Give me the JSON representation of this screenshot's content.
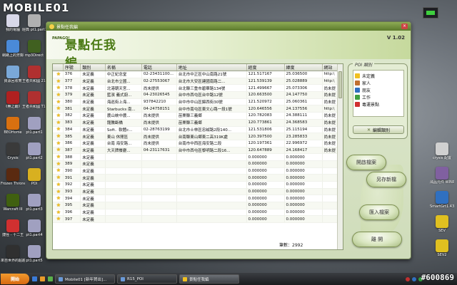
{
  "watermark": {
    "logo": "MOBILE01",
    "number": "#600869"
  },
  "desktop_icons": [
    {
      "label": "我的電腦",
      "color": "#d8d8e8"
    },
    {
      "label": "網路上的芳鄰",
      "color": "#4a8ad8"
    },
    {
      "label": "資源回收筒",
      "color": "#7aa8d8"
    },
    {
      "label": "《無之霸》",
      "color": "#b02020"
    },
    {
      "label": "BEOHome",
      "color": "#d87010"
    },
    {
      "label": "Crysis",
      "color": "#3a3a3a"
    },
    {
      "label": "Frozen Throne",
      "color": "#5a2a10"
    },
    {
      "label": "Warcraft III",
      "color": "#406010"
    },
    {
      "label": "捷徑 - 十二王",
      "color": "#d03030"
    },
    {
      "label": "來自世界的超越大戰",
      "color": "#303030"
    }
  ],
  "desktop_icons_col2": [
    {
      "label": "經典 pt1.part1",
      "color": "#b0b0b0"
    },
    {
      "label": "mp3Direct",
      "color": "#406020"
    },
    {
      "label": "王者共和國 2157",
      "color": "#b03030"
    },
    {
      "label": "王者共和國 T157",
      "color": "#b03030"
    },
    {
      "label": "pt1.part1",
      "color": "#a0a0c0"
    },
    {
      "label": "pt1.part2",
      "color": "#a0a0c0"
    },
    {
      "label": "POI",
      "color": "#d8b020"
    },
    {
      "label": "pt1.part3",
      "color": "#a0a0c0"
    },
    {
      "label": "pt1.part4",
      "color": "#a0a0c0"
    },
    {
      "label": "pt1.part5",
      "color": "#a0a0c0"
    }
  ],
  "desktop_icons_right": [
    {
      "label": "crysis 配置",
      "color": "#d0d0d0"
    },
    {
      "label": "飛品元件 WINRAR",
      "color": "#8060a0"
    },
    {
      "label": "SmartGrt1.43",
      "color": "#3070c0"
    },
    {
      "label": "SEV",
      "color": "#e0c020"
    },
    {
      "label": "SEV2",
      "color": "#e0c020"
    }
  ],
  "app": {
    "title": "景點任我編",
    "close": "×",
    "brand_small": "PAPAGO!",
    "brand_main": "景點任我編",
    "version": "V 1.02",
    "columns": [
      "",
      "序號",
      "類別",
      "名稱",
      "電話",
      "地址",
      "經度",
      "緯度",
      "網站"
    ],
    "rows": [
      [
        "376",
        "未定義",
        "中正紀念堂",
        "02-23431100...",
        "台北市中正區中山南路21號",
        "121.517167",
        "25.036500",
        "http:\\"
      ],
      [
        "377",
        "未定義",
        "台北市立國...",
        "02-27553067",
        "台北市大安區建國南路二...",
        "121.539139",
        "25.028889",
        "http:\\"
      ],
      [
        "378",
        "未定義",
        "北港朝天宮...",
        "尚未提供",
        "台北縣三重市碧華路134號",
        "121.499667",
        "25.073306",
        "尚未提"
      ],
      [
        "379",
        "未定義",
        "藍濱 義式廚...",
        "04-23026545",
        "台中市西屯區台中路12號",
        "120.663500",
        "24.147750",
        "尚未提"
      ],
      [
        "380",
        "未定義",
        "海巡街上海...",
        "937842210",
        "台中市中山區錦西街30號",
        "121.520972",
        "25.060361",
        "尚未提"
      ],
      [
        "381",
        "未定義",
        "Starbucks 南...",
        "04-24758151",
        "台中市南屯區東文心路一段1號",
        "120.646556",
        "24.137556",
        "http:\\"
      ],
      [
        "382",
        "未定義",
        "農山峽中農...",
        "尚未提供",
        "苗栗縣三義鄉",
        "120.782083",
        "24.388111",
        "尚未提"
      ],
      [
        "383",
        "未定義",
        "龍騰斷橋",
        "尚未提供",
        "苗栗縣三義鄉",
        "120.773861",
        "24.368583",
        "尚未提"
      ],
      [
        "384",
        "未定義",
        "Soft．軟體c...",
        "02-28763199",
        "台北市士林區忠誠路2段140...",
        "121.531806",
        "25.115194",
        "尚未提"
      ],
      [
        "385",
        "未定義",
        "東山 休閒區",
        "尚未提供",
        "台南縣東山鄉東二高319K處",
        "120.397500",
        "23.285833",
        "尚未提"
      ],
      [
        "386",
        "未定義",
        "台南 海安路...",
        "尚未提供",
        "台南市中西區海安路二段",
        "120.197361",
        "22.996972",
        "尚未提"
      ],
      [
        "387",
        "未定義",
        "大天牌餐廳...",
        "04-23117631",
        "台中市西屯區黎明路二段16...",
        "120.647889",
        "24.168417",
        "尚未提"
      ],
      [
        "388",
        "未定義",
        "",
        "",
        "",
        "0.000000",
        "0.000000",
        ""
      ],
      [
        "389",
        "未定義",
        "",
        "",
        "",
        "0.000000",
        "0.000000",
        ""
      ],
      [
        "390",
        "未定義",
        "",
        "",
        "",
        "0.000000",
        "0.000000",
        ""
      ],
      [
        "391",
        "未定義",
        "",
        "",
        "",
        "0.000000",
        "0.000000",
        ""
      ],
      [
        "392",
        "未定義",
        "",
        "",
        "",
        "0.000000",
        "0.000000",
        ""
      ],
      [
        "393",
        "未定義",
        "",
        "",
        "",
        "0.000000",
        "0.000000",
        ""
      ],
      [
        "394",
        "未定義",
        "",
        "",
        "",
        "0.000000",
        "0.000000",
        ""
      ],
      [
        "395",
        "未定義",
        "",
        "",
        "",
        "0.000000",
        "0.000000",
        ""
      ],
      [
        "396",
        "未定義",
        "",
        "",
        "",
        "0.000000",
        "0.000000",
        ""
      ],
      [
        "397",
        "未定義",
        "",
        "",
        "",
        "0.000000",
        "0.000000",
        ""
      ]
    ],
    "count_text": "筆數：2992",
    "poi_panel": {
      "title": "POI 類別",
      "items": [
        {
          "label": "未定義",
          "icon": "star-icon",
          "color": "#f0c020"
        },
        {
          "label": "家人",
          "icon": "house-icon",
          "color": "#c07030"
        },
        {
          "label": "朋友",
          "icon": "people-icon",
          "color": "#3070c0"
        },
        {
          "label": "工作",
          "icon": "briefcase-icon",
          "color": "#40a040"
        },
        {
          "label": "毒運景點",
          "icon": "flag-icon",
          "color": "#d03030"
        }
      ],
      "edit_label": "編輯類別"
    },
    "buttons": {
      "open": "開啟檔案",
      "save_as": "另存新檔",
      "import": "匯入檔案",
      "leave": "離 開"
    }
  },
  "taskbar": {
    "start": "開始",
    "tasks": [
      {
        "label": "Mobile01 [新年賀出]...",
        "active": false
      },
      {
        "label": "R15_POI",
        "active": false
      },
      {
        "label": "景點任我編",
        "active": true
      }
    ]
  }
}
